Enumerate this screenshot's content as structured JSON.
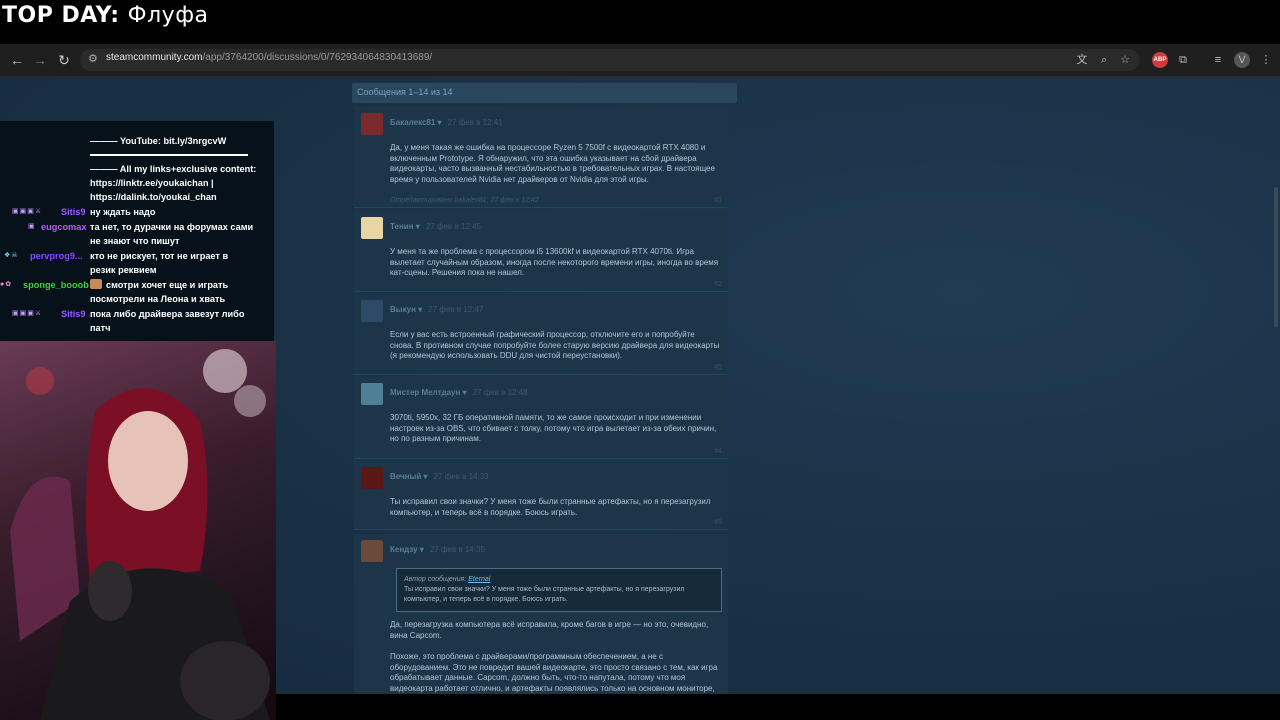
{
  "overlay": {
    "top_day_label": "TOP DAY:",
    "top_day_name": "Флуфа"
  },
  "browser": {
    "url_domain": "steamcommunity.com",
    "url_path": "/app/3764200/discussions/0/762934064830413689/",
    "abp_label": "ABP"
  },
  "thread": {
    "paging_text": "Сообщения 1–14 из 14",
    "posts": [
      {
        "author": "Бакалекс81",
        "date": "27 фев в 12:41",
        "body": "Да, у меня такая же ошибка на процессоре Ryzen 5 7500f с видеокартой RTX 4080 и включенным Prototype. Я обнаружил, что эта ошибка указывает на сбой драйвера видеокарты, часто вызванный нестабильностью в требовательных играх. В настоящее время у пользователей Nvidia нет драйверов от Nvidia для этой игры.",
        "edited": "Отредактировано bakalex81; 27 фев в 12:42",
        "num": "#1",
        "avatar_color": "#7a2a2a"
      },
      {
        "author": "Тенин",
        "date": "27 фев в 12:45",
        "body": "У меня та же проблема с процессором i5 13600kf и видеокартой RTX 4070ti. Игра вылетает случайным образом, иногда после некоторого времени игры, иногда во время кат-сцены. Решения пока не нашел.",
        "num": "#2",
        "avatar_color": "#e7d6a4"
      },
      {
        "author": "Выкун",
        "date": "27 фев в 12:47",
        "body": "Если у вас есть встроенный графический процессор, отключите его и попробуйте снова. В противном случае попробуйте более старую версию драйвера для видеокарты (я рекомендую использовать DDU для чистой переустановки).",
        "num": "#3",
        "avatar_color": "#2e4a66"
      },
      {
        "author": "Мистер Мелтдаун",
        "date": "27 фев в 12:48",
        "body": "3070ti, 5950x, 32 ГБ оперативной памяти, то же самое происходит и при изменении настроек из-за OBS, что сбивает с толку, потому что игра вылетает из-за обеих причин, но по разным причинам.",
        "num": "#4",
        "avatar_color": "#4f7f95"
      },
      {
        "author": "Вечный",
        "date": "27 фев в 14:33",
        "body": "Ты исправил свои значки? У меня тоже были странные артефакты, но я перезагрузил компьютер, и теперь всё в порядке. Боюсь играть.",
        "num": "#5",
        "avatar_color": "#5b1616"
      },
      {
        "author": "Кендзу",
        "date": "27 фев в 14:35",
        "quote_header": "Автор сообщения:",
        "quote_name": "Eternal",
        "quote_text": "Ты исправил свои значки? У меня тоже были странные артефакты, но я перезагрузил компьютер, и теперь всё в порядке. Боюсь играть.",
        "body": "Да, перезагрузка компьютера всё исправила, кроме багов в игре — но это, очевидно, вина Capcom.",
        "body2": "Похоже, это проблема с драйверами/программным обеспечением, а не с оборудованием. Это не повредит вашей видеокарте, это просто связано с тем, как игра обрабатывает данные. Capcom, должно быть, что-то напутала, потому что моя видеокарта работает отлично, и артефакты появлялись только на основном мониторе, на котором была",
        "avatar_color": "#6b4a3a"
      }
    ]
  },
  "chat": {
    "lines": [
      {
        "text": "——— YouTube: bit.ly/3nrgcvW"
      },
      {
        "text": "——— All my links+exclusive content:"
      },
      {
        "text": "https://linktr.ee/youkaichan |"
      },
      {
        "text": "https://dalink.to/youkai_chan"
      }
    ],
    "messages": [
      {
        "user": "Sitis9",
        "user_color": "#9b59ff",
        "text": "ну ждать надо",
        "badges": "▣▣▣⚔"
      },
      {
        "user": "eugcomax",
        "user_color": "#b05cff",
        "text": "та нет, то дурачки на форумах сами",
        "text2": "не знают что пишут",
        "badges": "▣"
      },
      {
        "user": "pervprog9...",
        "user_color": "#8e44ff",
        "text": "кто не рискует, тот не играет в",
        "text2": "резик реквием",
        "badges": "❖☠"
      },
      {
        "user": "sponge_booob",
        "user_color": "#3cd13c",
        "text": "смотри хочет еще и играть",
        "text2": "посмотрели на Леона и хвать",
        "badges": "●✿"
      },
      {
        "user": "Sitis9",
        "user_color": "#9b59ff",
        "text": "пока либо драйвера завезут либо",
        "text2": "патч",
        "badges": "▣▣▣⚔"
      }
    ]
  }
}
